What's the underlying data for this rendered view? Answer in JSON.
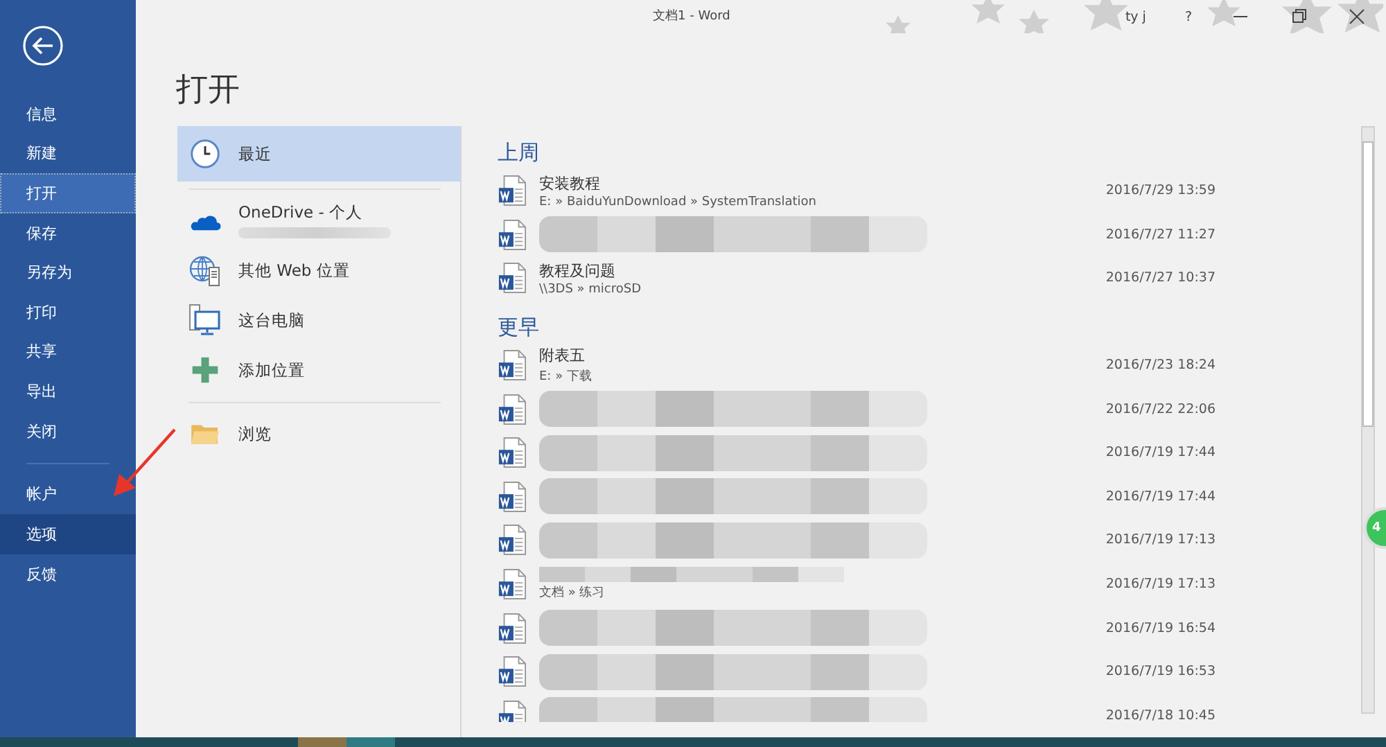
{
  "window": {
    "title": "文档1 - Word",
    "user": "ty j",
    "help": "?"
  },
  "sidebar": {
    "items": [
      {
        "label": "信息",
        "selected": false,
        "hovered": false,
        "divider_before": false
      },
      {
        "label": "新建",
        "selected": false,
        "hovered": false,
        "divider_before": false
      },
      {
        "label": "打开",
        "selected": true,
        "hovered": false,
        "divider_before": false
      },
      {
        "label": "保存",
        "selected": false,
        "hovered": false,
        "divider_before": false
      },
      {
        "label": "另存为",
        "selected": false,
        "hovered": false,
        "divider_before": false
      },
      {
        "label": "打印",
        "selected": false,
        "hovered": false,
        "divider_before": false
      },
      {
        "label": "共享",
        "selected": false,
        "hovered": false,
        "divider_before": false
      },
      {
        "label": "导出",
        "selected": false,
        "hovered": false,
        "divider_before": false
      },
      {
        "label": "关闭",
        "selected": false,
        "hovered": false,
        "divider_before": false
      },
      {
        "label": "帐户",
        "selected": false,
        "hovered": false,
        "divider_before": true
      },
      {
        "label": "选项",
        "selected": false,
        "hovered": true,
        "divider_before": false
      },
      {
        "label": "反馈",
        "selected": false,
        "hovered": false,
        "divider_before": false
      }
    ]
  },
  "page_title": "打开",
  "locations": [
    {
      "kind": "clock",
      "label": "最近",
      "selected": true,
      "divider_after": true,
      "redacted_sub": false
    },
    {
      "kind": "cloud",
      "label": "OneDrive - 个人",
      "selected": false,
      "divider_after": false,
      "redacted_sub": true
    },
    {
      "kind": "globe",
      "label": "其他 Web 位置",
      "selected": false,
      "divider_after": false,
      "redacted_sub": false
    },
    {
      "kind": "computer",
      "label": "这台电脑",
      "selected": false,
      "divider_after": false,
      "redacted_sub": false
    },
    {
      "kind": "plus",
      "label": "添加位置",
      "selected": false,
      "divider_after": true,
      "redacted_sub": false
    },
    {
      "kind": "folder",
      "label": "浏览",
      "selected": false,
      "divider_after": false,
      "redacted_sub": false
    }
  ],
  "groups": [
    {
      "heading": "上周",
      "files": [
        {
          "name": "安装教程",
          "path": "E: » BaiduYunDownload » SystemTranslation",
          "date": "2016/7/29 13:59",
          "redacted": false
        },
        {
          "date": "2016/7/27 11:27",
          "redacted": true
        },
        {
          "name": "教程及问题",
          "path": "\\\\3DS » microSD",
          "date": "2016/7/27 10:37",
          "redacted": false
        }
      ]
    },
    {
      "heading": "更早",
      "files": [
        {
          "name": "附表五",
          "path": "E: » 下载",
          "date": "2016/7/23 18:24",
          "redacted": false
        },
        {
          "date": "2016/7/22 22:06",
          "redacted": true
        },
        {
          "date": "2016/7/19 17:44",
          "redacted": true
        },
        {
          "date": "2016/7/19 17:44",
          "redacted": true
        },
        {
          "date": "2016/7/19 17:13",
          "redacted": true
        },
        {
          "path": "文档 » 练习",
          "date": "2016/7/19 17:13",
          "redacted": true
        },
        {
          "date": "2016/7/19 16:54",
          "redacted": true
        },
        {
          "date": "2016/7/19 16:53",
          "redacted": true
        },
        {
          "date": "2016/7/18 10:45",
          "redacted": true
        }
      ]
    }
  ],
  "float_badge": "4"
}
